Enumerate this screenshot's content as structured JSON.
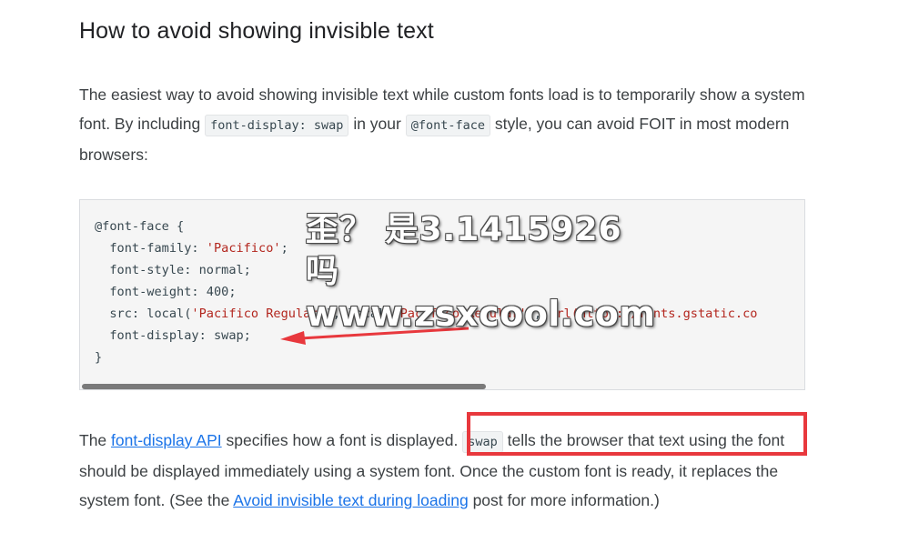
{
  "heading": "How to avoid showing invisible text",
  "intro": {
    "part1": "The easiest way to avoid showing invisible text while custom fonts load is to temporarily show a system font. By including ",
    "code1": "font-display: swap",
    "part2": " in your ",
    "code2": "@font-face",
    "part3": " style, you can avoid FOIT in most modern browsers:"
  },
  "code_block": {
    "line1": "@font-face {",
    "prop_family": "  font-family: ",
    "val_family": "'Pacifico'",
    "end_family": ";",
    "line_style": "  font-style: normal;",
    "line_weight": "  font-weight: 400;",
    "src_prop": "  src: local(",
    "src_str1": "'Pacifico Regular'",
    "src_mid": "), local(",
    "src_str2": "'Pacifico-Regular'",
    "src_mid2": "), ",
    "src_url": "url(https://fonts.gstatic.co",
    "line_display": "  font-display: swap;",
    "line_close": "}"
  },
  "outro": {
    "part1": "The ",
    "link1": "font-display API",
    "part2": " specifies how a font is displayed. ",
    "code1": "swap",
    "part3": " tells the browser that text using the font should be displayed immediately using a system font. Once the custom font is ready, it replaces the system font. (See the ",
    "link2": "Avoid invisible text during loading",
    "part4": " post for more information.)"
  },
  "watermark": {
    "line1": "歪？ 是3.1415926吗",
    "line2": "www.zsxcool.com"
  },
  "colors": {
    "highlight": "#e8383d",
    "link": "#1a73e8",
    "string": "#b3261e"
  }
}
